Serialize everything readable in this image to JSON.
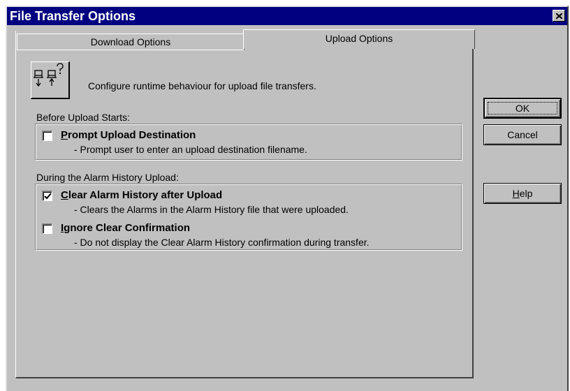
{
  "window": {
    "title": "File Transfer Options",
    "close_icon": "close-icon"
  },
  "tabs": [
    {
      "label": "Download Options",
      "active": false
    },
    {
      "label": "Upload Options",
      "active": true
    }
  ],
  "header": {
    "icon": "upload-transfer-icon",
    "description": "Configure runtime behaviour for upload file transfers."
  },
  "before_upload": {
    "label": "Before Upload Starts:",
    "options": [
      {
        "label": "Prompt Upload Destination",
        "description": "- Prompt user to enter an upload destination filename.",
        "checked": false
      }
    ]
  },
  "during_upload": {
    "label": "During the Alarm History Upload:",
    "options": [
      {
        "label": "Clear Alarm History after Upload",
        "description": "- Clears the Alarms in the Alarm History file that were uploaded.",
        "checked": true
      },
      {
        "label": "Ignore Clear Confirmation",
        "description": "- Do not display the Clear Alarm History confirmation during transfer.",
        "checked": false
      }
    ]
  },
  "buttons": {
    "ok": "OK",
    "cancel": "Cancel",
    "help": "Help"
  },
  "colors": {
    "titlebar": "#000080",
    "face": "#c0c0c0"
  }
}
